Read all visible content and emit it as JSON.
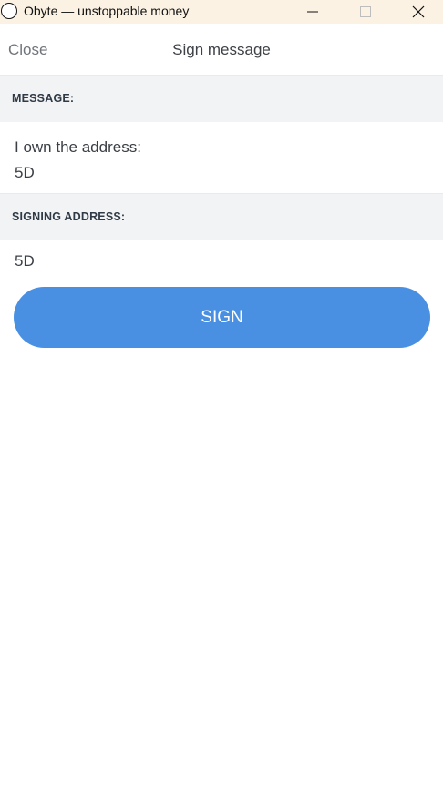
{
  "window": {
    "title": "Obyte — unstoppable money",
    "icons": {
      "app": "circle-icon",
      "minimize": "minimize-icon",
      "maximize": "maximize-icon",
      "close": "close-icon"
    }
  },
  "header": {
    "close_label": "Close",
    "title": "Sign message"
  },
  "message_section": {
    "label": "MESSAGE:",
    "lines": [
      "I own the address:",
      "5D"
    ]
  },
  "address_section": {
    "label": "SIGNING ADDRESS:",
    "value": "5D"
  },
  "actions": {
    "sign_label": "SIGN"
  },
  "colors": {
    "titlebar": "#fbf2e4",
    "section_bg": "#f1f3f5",
    "accent": "#4a90e2"
  }
}
